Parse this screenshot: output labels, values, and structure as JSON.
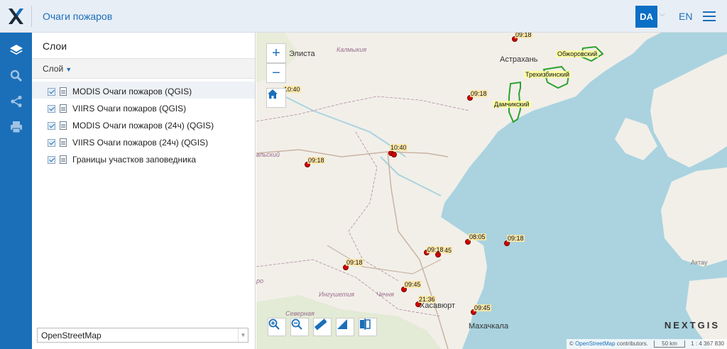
{
  "header": {
    "title": "Очаги пожаров",
    "lang_active": "DA",
    "lang_alt": "EN",
    "accent_color": "#1a6fb8"
  },
  "rail": {
    "items": [
      "layers-icon",
      "search-icon",
      "share-icon",
      "print-icon"
    ]
  },
  "panel": {
    "title": "Слои",
    "column_label": "Слой",
    "layers": [
      {
        "label": "MODIS Очаги пожаров (QGIS)",
        "checked": true
      },
      {
        "label": "VIIRS Очаги пожаров (QGIS)",
        "checked": true
      },
      {
        "label": "MODIS Очаги пожаров (24ч) (QGIS)",
        "checked": true
      },
      {
        "label": "VIIRS Очаги пожаров (24ч) (QGIS)",
        "checked": true
      },
      {
        "label": "Границы участков заповедника",
        "checked": true
      }
    ],
    "basemap": "OpenStreetMap"
  },
  "map": {
    "labels": {
      "elista": "Элиста",
      "kalmykia": "Калмыкия",
      "astrakhan": "Астрахань",
      "makhachkala": "Махачкала",
      "khasavyurt": "Хасавюрт",
      "chechnya": "Чечня",
      "ingushetia": "Ингушетия",
      "severnaya": "Северная",
      "aktau": "Актау",
      "kavkaz_frag": "вльский",
      "rou_frag": "ро"
    },
    "reserves": [
      "Обжоровский",
      "Трехизбинский",
      "Дамчикский"
    ],
    "fires": [
      "09:18",
      "09:18",
      "10:40",
      "09:18",
      "10:40",
      "08:05",
      "09:18",
      "09:18",
      "45",
      "09:18",
      "09:45",
      "21:36",
      "09:45"
    ],
    "attribution_prefix": "©",
    "attribution_link": "OpenStreetMap",
    "attribution_suffix": "contributors.",
    "scale_label": "50 km",
    "scale_ratio": "1 : 4 367 830",
    "brand": "NEXTGIS"
  }
}
